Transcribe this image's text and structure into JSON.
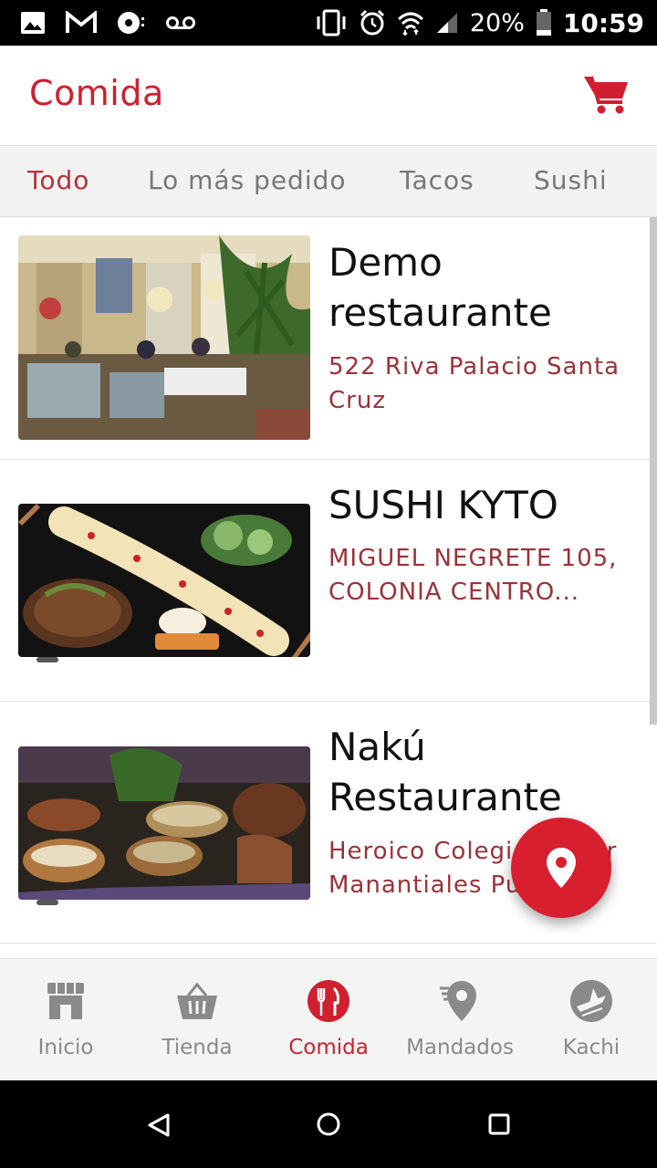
{
  "status_bar": {
    "battery": "20%",
    "time": "10:59",
    "icons": [
      "image-icon",
      "gmail-icon",
      "podcast-icon",
      "voicemail-icon",
      "vibrate-icon",
      "alarm-icon",
      "wifi-icon",
      "signal-icon",
      "battery-icon"
    ]
  },
  "app_bar": {
    "title": "Comida",
    "cart_icon": "cart-icon"
  },
  "tabs": [
    {
      "label": "Todo",
      "active": true
    },
    {
      "label": "Lo más pedido",
      "active": false
    },
    {
      "label": "Tacos",
      "active": false
    },
    {
      "label": "Sushi",
      "active": false
    }
  ],
  "restaurants": [
    {
      "name": "Demo restaurante",
      "address": "522 Riva Palacio Santa Cruz"
    },
    {
      "name": "SUSHI KYTO",
      "address": "MIGUEL NEGRETE 105, COLONIA CENTRO..."
    },
    {
      "name": "Nakú Restaurante",
      "address": "Heroico Colegio Militar Manantiales Pu...a"
    }
  ],
  "fab": {
    "icon": "location-pin-icon"
  },
  "bottom_nav": [
    {
      "label": "Inicio",
      "icon": "store-icon",
      "active": false
    },
    {
      "label": "Tienda",
      "icon": "basket-icon",
      "active": false
    },
    {
      "label": "Comida",
      "icon": "utensils-icon",
      "active": true
    },
    {
      "label": "Mandados",
      "icon": "delivery-pin-icon",
      "active": false
    },
    {
      "label": "Kachi",
      "icon": "kachi-icon",
      "active": false
    }
  ],
  "colors": {
    "brand_red": "#d01f2f",
    "address_red": "#9a3238",
    "tab_active": "#b9303a"
  }
}
